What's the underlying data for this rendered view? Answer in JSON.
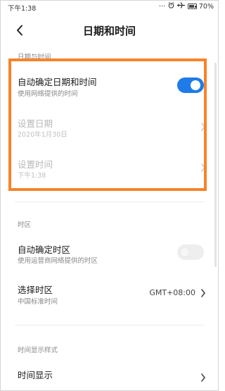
{
  "status_bar": {
    "time": "下午1:38",
    "dots": "···",
    "battery": "70%",
    "icons": [
      "airplane-icon",
      "alarm-icon",
      "battery-icon"
    ]
  },
  "header": {
    "title": "日期和时间",
    "back_icon": "chevron-left-icon"
  },
  "sections": {
    "date_time": {
      "header": "日期与时间",
      "auto_date": {
        "title": "自动确定日期和时间",
        "subtitle": "使用网络提供的时间",
        "toggle": "on"
      },
      "set_date": {
        "title": "设置日期",
        "subtitle": "2020年1月30日"
      },
      "set_time": {
        "title": "设置时间",
        "subtitle": "下午1:38"
      }
    },
    "timezone": {
      "header": "时区",
      "auto_zone": {
        "title": "自动确定时区",
        "subtitle": "使用运营商网络提供的时区",
        "toggle": "off"
      },
      "select_zone": {
        "title": "选择时区",
        "subtitle": "中国标准时间",
        "value": "GMT+08:00"
      }
    },
    "display": {
      "header": "时间显示样式",
      "time_display": {
        "title": "时间显示"
      }
    }
  },
  "colors": {
    "accent": "#1f7be8",
    "highlight": "#f7832a",
    "disabled_text": "#b8b8b8"
  }
}
